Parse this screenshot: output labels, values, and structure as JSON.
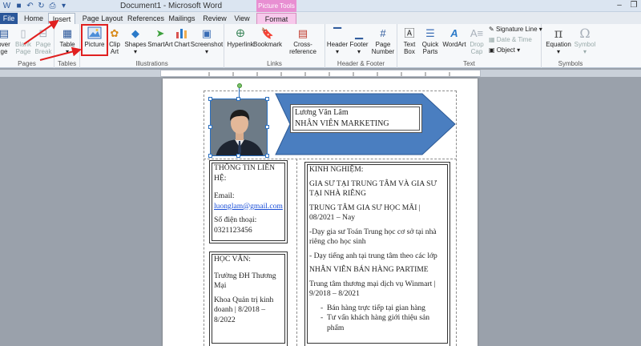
{
  "window": {
    "title": "Document1 - Microsoft Word",
    "picture_tools_label": "Picture Tools"
  },
  "tabs": [
    {
      "label": "File"
    },
    {
      "label": "Home"
    },
    {
      "label": "Insert"
    },
    {
      "label": "Page Layout"
    },
    {
      "label": "References"
    },
    {
      "label": "Mailings"
    },
    {
      "label": "Review"
    },
    {
      "label": "View"
    },
    {
      "label": "Format"
    }
  ],
  "ribbon": {
    "pages": {
      "label": "Pages",
      "cover": "over\nge",
      "blank": "Blank\nPage",
      "break": "Page\nBreak"
    },
    "tables": {
      "label": "Tables",
      "table": "Table"
    },
    "illustrations": {
      "label": "Illustrations",
      "picture": "Picture",
      "clip_art": "Clip\nArt",
      "shapes": "Shapes",
      "smartart": "SmartArt",
      "chart": "Chart",
      "screenshot": "Screenshot"
    },
    "links": {
      "label": "Links",
      "hyperlink": "Hyperlink",
      "bookmark": "Bookmark",
      "cross_reference": "Cross-reference"
    },
    "header_footer": {
      "label": "Header & Footer",
      "header": "Header",
      "footer": "Footer",
      "page_number": "Page\nNumber"
    },
    "text": {
      "label": "Text",
      "text_box": "Text\nBox",
      "quick_parts": "Quick\nParts",
      "wordart": "WordArt",
      "drop_cap": "Drop\nCap",
      "signature_line": "Signature Line",
      "date_time": "Date & Time",
      "object": "Object"
    },
    "symbols": {
      "label": "Symbols",
      "equation": "Equation",
      "symbol": "Symbol"
    }
  },
  "cv": {
    "name": "Lương Văn Lâm",
    "position": "NHÂN VIÊN MARKETING",
    "contact": {
      "heading": "THÔNG TIN LIÊN HỆ:",
      "email_label": "Email:",
      "email": "luonglam@gmail.com",
      "phone_label": "Số điện thoại:",
      "phone": "0321123456"
    },
    "education": {
      "heading": "HỌC VẤN:",
      "school": "Trường ĐH Thương Mại",
      "faculty": "Khoa Quản trị kinh doanh | 8/2018 – 8/2022"
    },
    "experience": {
      "heading": "KINH NGHIỆM:",
      "job1_title": "GIA SƯ TẠI TRUNG TÂM VÀ GIA SƯ TẠI NHÀ RIÊNG",
      "job1_company": "TRUNG TÂM GIA SƯ HỌC MÃI | 08/2021 – Nay",
      "job1_task1": "-Dạy gia sư Toán Trung học cơ sở tại nhà riêng cho học sinh",
      "job1_task2": "- Dạy tiếng anh tại trung tâm theo các lớp",
      "job2_title": "NHÂN VIÊN BÁN HÀNG PARTIME",
      "job2_company": "Trung tâm thương mại dịch vụ Winmart | 9/2018 – 8/2021",
      "job2_tasks": [
        "Bán hàng trực tiếp tại gian hàng",
        "Tư vấn khách hàng giới thiệu sản phẩm"
      ]
    }
  },
  "colors": {
    "accent": "#2b579a",
    "arrow_fill": "#4a7ec0",
    "highlight": "#e02020"
  }
}
